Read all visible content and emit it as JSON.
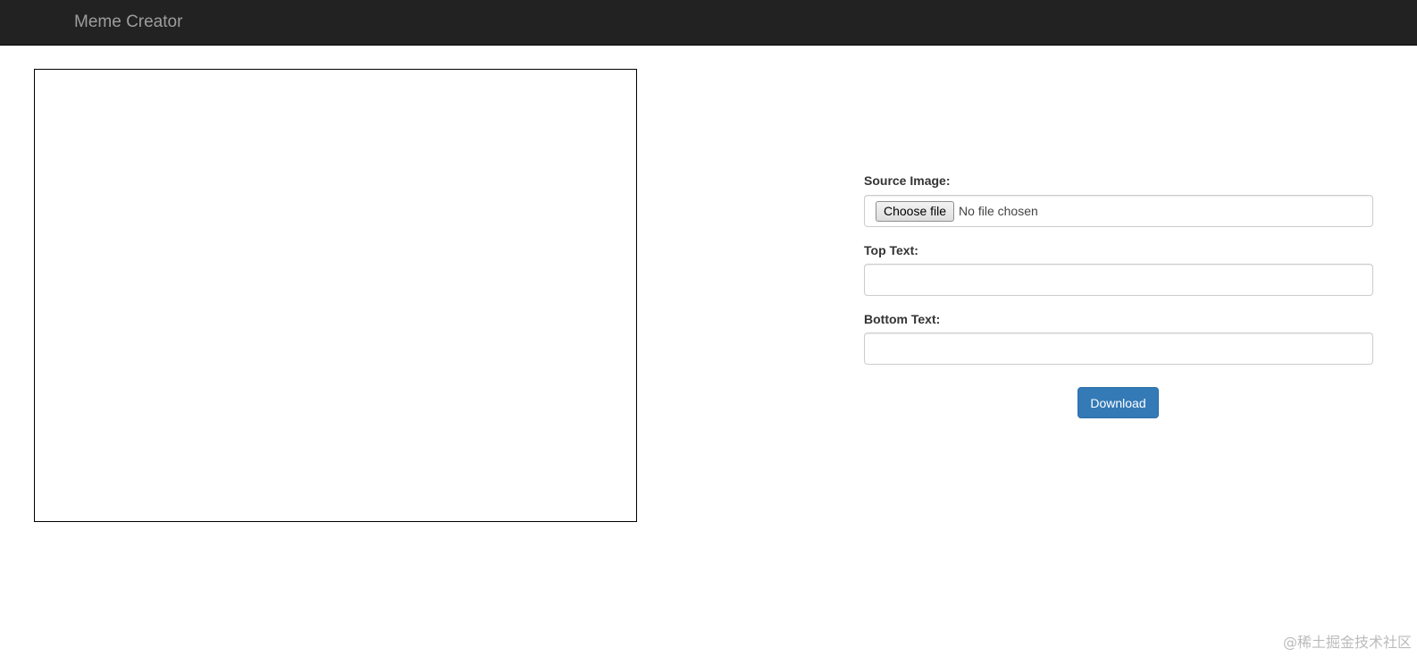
{
  "navbar": {
    "brand": "Meme Creator"
  },
  "form": {
    "source_image_label": "Source Image:",
    "choose_file_label": "Choose file",
    "file_status": "No file chosen",
    "top_text_label": "Top Text:",
    "top_text_value": "",
    "bottom_text_label": "Bottom Text:",
    "bottom_text_value": "",
    "download_label": "Download"
  },
  "watermark": "@稀土掘金技术社区",
  "colors": {
    "navbar_bg": "#222222",
    "brand_text": "#9d9d9d",
    "primary_button": "#337ab7"
  }
}
